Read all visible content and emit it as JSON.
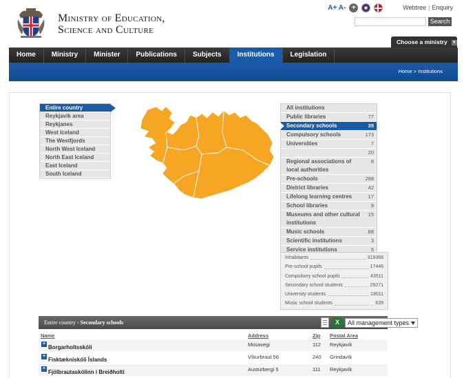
{
  "header": {
    "title_line1": "Ministry of Education,",
    "title_line2": "Science and Culture",
    "font_size_control": "A+ A-",
    "links": [
      "Webtree",
      "Enquiry"
    ],
    "search_placeholder": "",
    "search_button": "Search",
    "choose_ministry": "Choose a ministry"
  },
  "nav": {
    "items": [
      "Home",
      "Ministry",
      "Minister",
      "Publications",
      "Subjects",
      "Institutions",
      "Legislation"
    ],
    "active": "Institutions"
  },
  "breadcrumb": "Home > Institutions",
  "regions": {
    "items": [
      "Entire country",
      "Reykjavík area",
      "Reykjanes",
      "West Iceland",
      "The Westfjords",
      "North West Iceland",
      "North East Iceland",
      "East Iceland",
      "South Iceland"
    ],
    "active": "Entire country"
  },
  "categories": {
    "items": [
      {
        "name": "All institutions",
        "count": ""
      },
      {
        "name": "Public libraries",
        "count": "77"
      },
      {
        "name": "Secondary schools",
        "count": "35"
      },
      {
        "name": "Compulsory schools",
        "count": "173"
      },
      {
        "name": "Universities",
        "count": "7"
      },
      {
        "name": "",
        "count": "20"
      },
      {
        "name": "Regional associations of local authorities",
        "count": "8"
      },
      {
        "name": "Pre-schools",
        "count": "288"
      },
      {
        "name": "District libraries",
        "count": "42"
      },
      {
        "name": "Lifelong learning centres",
        "count": "17"
      },
      {
        "name": "School libraries",
        "count": "9"
      },
      {
        "name": "Museums and other cultural institutions",
        "count": "15"
      },
      {
        "name": "Music schools",
        "count": "88"
      },
      {
        "name": "Scientific institutions",
        "count": "3"
      },
      {
        "name": "Service institutions",
        "count": "5"
      }
    ],
    "active": "Secondary schools"
  },
  "stats": [
    {
      "label": "Inhabitants",
      "value": "319368"
    },
    {
      "label": "Pre-school pupils",
      "value": "17446"
    },
    {
      "label": "Compulsory school pupils",
      "value": "43511"
    },
    {
      "label": "Secondary school students",
      "value": "29271"
    },
    {
      "label": "University students",
      "value": "18011"
    },
    {
      "label": "Music school students",
      "value": "639"
    }
  ],
  "results": {
    "crumb_region": "Entire country",
    "crumb_arrow": "›",
    "crumb_category": "Secondary schools",
    "management_select": "All management types",
    "columns": {
      "name": "Name",
      "address": "Address",
      "zip": "Zip",
      "area": "Postal Area"
    },
    "rows": [
      {
        "name": "Borgarholtsskóli",
        "address": "Mosavegi",
        "zip": "112",
        "area": "Reykjavík"
      },
      {
        "name": "Fisktækniskóli Íslands",
        "address": "Víkurbraut 56",
        "zip": "240",
        "area": "Grindavík"
      },
      {
        "name": "Fjölbrautaskólinn í Breiðholti",
        "address": "Austurbergi 5",
        "zip": "111",
        "area": "Reykjavík"
      }
    ]
  },
  "colors": {
    "accent": "#1b5aa8",
    "nav": "#2b2b2b",
    "map": "#f7a623"
  },
  "icons": {
    "crest": "iceland-coat-of-arms-icon",
    "zoom": "plus-circle-icon",
    "english": "uk-flag-icon",
    "danish": "denmark-flag-icon",
    "document": "document-icon",
    "excel": "excel-icon"
  }
}
